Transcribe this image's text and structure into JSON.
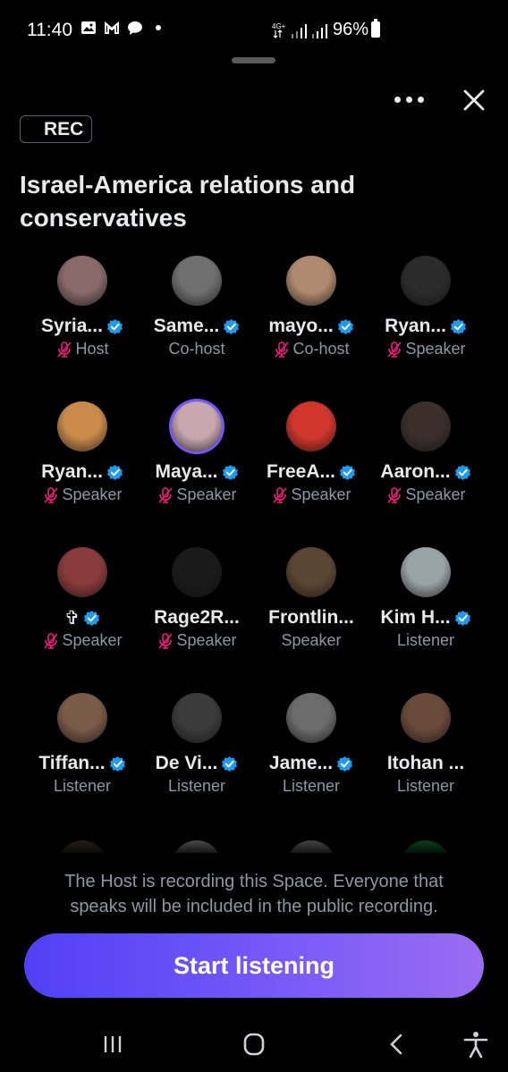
{
  "status_bar": {
    "time": "11:40",
    "network": "4G+",
    "battery": "96%",
    "icons": [
      "image-icon",
      "gmail-icon",
      "chat-icon",
      "dot-icon",
      "signal-icon",
      "battery-icon"
    ]
  },
  "space": {
    "rec_label": "REC",
    "title": "Israel-America relations and conservatives"
  },
  "participants": [
    {
      "name": "Syria...",
      "role": "Host",
      "verified": true,
      "muted": true,
      "avatar_color": "#8a6a6a"
    },
    {
      "name": "Same...",
      "role": "Co-host",
      "verified": true,
      "muted": false,
      "avatar_color": "#6f6f6f"
    },
    {
      "name": "mayo...",
      "role": "Co-host",
      "verified": true,
      "muted": true,
      "avatar_color": "#b08a6e"
    },
    {
      "name": "Ryan...",
      "role": "Speaker",
      "verified": true,
      "muted": true,
      "avatar_color": "#2b2b2b"
    },
    {
      "name": "Ryan...",
      "role": "Speaker",
      "verified": true,
      "muted": true,
      "avatar_color": "#c98a4a"
    },
    {
      "name": "Maya...",
      "role": "Speaker",
      "verified": true,
      "muted": true,
      "avatar_color": "#c9a7b0"
    },
    {
      "name": "FreeA...",
      "role": "Speaker",
      "verified": true,
      "muted": true,
      "avatar_color": "#d0362c"
    },
    {
      "name": "Aaron...",
      "role": "Speaker",
      "verified": true,
      "muted": true,
      "avatar_color": "#3a2f2a"
    },
    {
      "name": "✞",
      "role": "Speaker",
      "verified": true,
      "muted": true,
      "avatar_color": "#8a3b3b"
    },
    {
      "name": "Rage2R...",
      "role": "Speaker",
      "verified": false,
      "muted": true,
      "avatar_color": "#1a1a1a"
    },
    {
      "name": "Frontlin...",
      "role": "Speaker",
      "verified": false,
      "muted": false,
      "avatar_color": "#5b4634"
    },
    {
      "name": "Kim H...",
      "role": "Listener",
      "verified": true,
      "muted": false,
      "avatar_color": "#9aa3a6"
    },
    {
      "name": "Tiffan...",
      "role": "Listener",
      "verified": true,
      "muted": false,
      "avatar_color": "#7a5a48"
    },
    {
      "name": "De Vi...",
      "role": "Listener",
      "verified": true,
      "muted": false,
      "avatar_color": "#3b3b3b"
    },
    {
      "name": "Jame...",
      "role": "Listener",
      "verified": true,
      "muted": false,
      "avatar_color": "#6c6c6c"
    },
    {
      "name": "Itohan ...",
      "role": "Listener",
      "verified": false,
      "muted": false,
      "avatar_color": "#6a4a3a"
    }
  ],
  "recording_notice": "The Host is recording this Space. Everyone that speaks will be included in the public recording.",
  "cta": {
    "label": "Start listening"
  },
  "colors": {
    "verified": "#1d9bf0",
    "muted_mic": "#f91880",
    "accent_start": "#5140f5",
    "accent_end": "#9b6cf0"
  },
  "nav": {
    "icons": [
      "recent-apps-icon",
      "home-icon",
      "back-icon",
      "accessibility-icon"
    ]
  }
}
